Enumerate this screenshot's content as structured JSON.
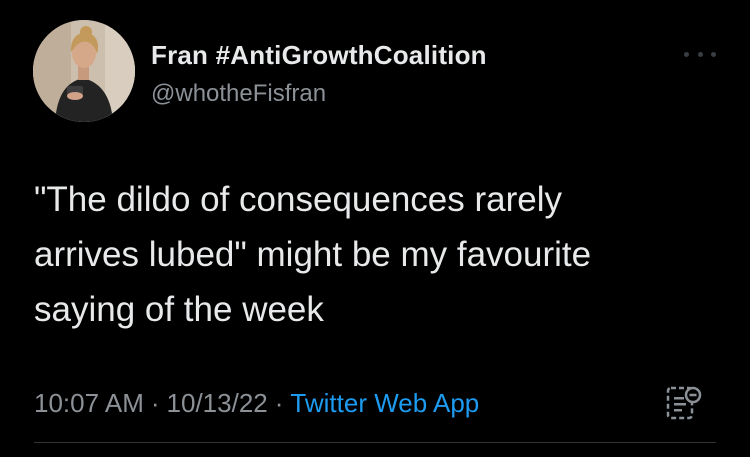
{
  "tweet": {
    "author": {
      "display_name": "Fran #AntiGrowthCoalition",
      "handle": "@whotheFisfran",
      "avatar_icon": "profile-photo"
    },
    "text": "\"The dildo of consequences rarely\narrives lubed\" might be my favourite\nsaying of the week",
    "time": "10:07 AM",
    "date": "10/13/22",
    "separator": "·",
    "source": "Twitter Web App",
    "more_icon": "more-horizontal-icon",
    "analytics_icon": "analytics-icon"
  },
  "colors": {
    "background": "#000000",
    "primary_text": "#e7e9ea",
    "secondary_text": "#8b9196",
    "link": "#1d9bf0",
    "divider": "#2f3336"
  }
}
